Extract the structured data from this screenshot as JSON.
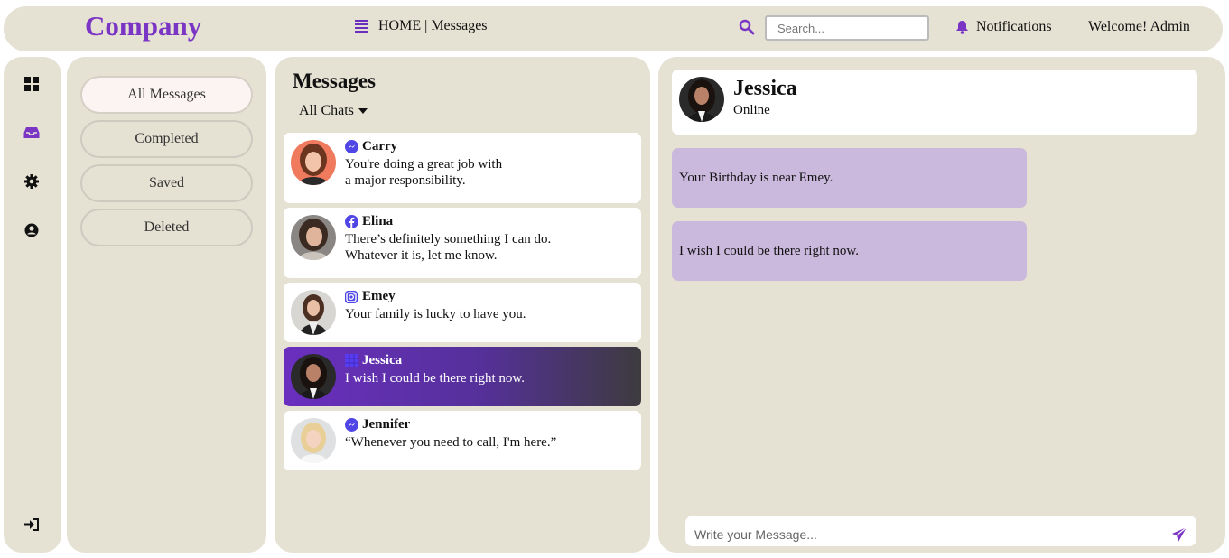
{
  "brand": "Company",
  "nav": {
    "home": "HOME",
    "separator": "|",
    "current": "Messages"
  },
  "search": {
    "placeholder": "Search...",
    "value": ""
  },
  "notifications_label": "Notifications",
  "welcome": "Welcome! Admin",
  "rail": {
    "icons": [
      "dashboard-icon",
      "inbox-icon",
      "gear-icon",
      "user-circle-icon",
      "sign-in-icon"
    ]
  },
  "folders": [
    {
      "label": "All Messages",
      "active": true
    },
    {
      "label": "Completed",
      "active": false
    },
    {
      "label": "Saved",
      "active": false
    },
    {
      "label": "Deleted",
      "active": false
    }
  ],
  "messages": {
    "title": "Messages",
    "filter": "All Chats",
    "chats": [
      {
        "name": "Carry",
        "source": "messenger-icon",
        "lines": [
          "You're doing a great job with",
          "a major responsibility."
        ],
        "active": false
      },
      {
        "name": "Elina",
        "source": "facebook-icon",
        "lines": [
          "There’s definitely something I can do.",
          "Whatever it is, let me know."
        ],
        "active": false
      },
      {
        "name": "Emey",
        "source": "instagram-icon",
        "lines": [
          "Your family is lucky to have you."
        ],
        "active": false
      },
      {
        "name": "Jessica",
        "source": "grid-icon",
        "lines": [
          "I wish I could be there right now."
        ],
        "active": true
      },
      {
        "name": "Jennifer",
        "source": "messenger-icon",
        "lines": [
          "“Whenever you need to call, I'm here.”"
        ],
        "active": false
      }
    ]
  },
  "conversation": {
    "name": "Jessica",
    "status": "Online",
    "bubbles": [
      "Your Birthday is near Emey.",
      "I wish I could be there right now."
    ],
    "composer_placeholder": "Write your Message..."
  },
  "colors": {
    "accent": "#7b35c4",
    "panel": "#e5e1d3",
    "bubble": "#cbb9dd",
    "messenger": "#4f46e5"
  }
}
